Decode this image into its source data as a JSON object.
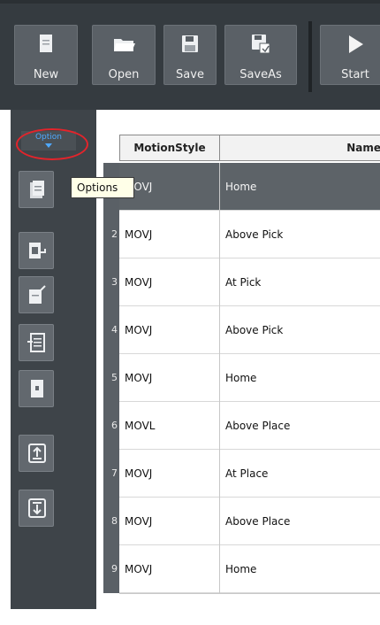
{
  "toolbar": {
    "buttons": [
      {
        "id": "new",
        "label": "New",
        "icon": "new-file-icon"
      },
      {
        "id": "open",
        "label": "Open",
        "icon": "folder-open-icon"
      },
      {
        "id": "save",
        "label": "Save",
        "icon": "floppy-disk-icon"
      },
      {
        "id": "saveas",
        "label": "SaveAs",
        "icon": "save-as-icon"
      },
      {
        "id": "start",
        "label": "Start",
        "icon": "play-icon"
      }
    ]
  },
  "sidebar": {
    "option_label": "Option",
    "tooltip": "Options",
    "tool_icons": [
      "options-document-icon",
      "export-document-icon",
      "edit-document-icon",
      "import-document-icon",
      "blank-document-icon",
      "move-up-icon",
      "move-down-icon"
    ]
  },
  "table": {
    "columns": [
      "MotionStyle",
      "Name"
    ],
    "rows": [
      {
        "num": "1",
        "style": "MOVJ",
        "name": "Home"
      },
      {
        "num": "2",
        "style": "MOVJ",
        "name": "Above Pick"
      },
      {
        "num": "3",
        "style": "MOVJ",
        "name": "At Pick"
      },
      {
        "num": "4",
        "style": "MOVJ",
        "name": "Above Pick"
      },
      {
        "num": "5",
        "style": "MOVJ",
        "name": "Home"
      },
      {
        "num": "6",
        "style": "MOVL",
        "name": "Above Place"
      },
      {
        "num": "7",
        "style": "MOVJ",
        "name": "At Place"
      },
      {
        "num": "8",
        "style": "MOVJ",
        "name": "Above Place"
      },
      {
        "num": "9",
        "style": "MOVJ",
        "name": "Home"
      }
    ]
  },
  "colors": {
    "toolbar_bg": "#353b40",
    "button_bg": "#5a6066",
    "option_text": "#4fa9ff",
    "highlight_oval": "#e3242b",
    "selected_row": "#5d6368"
  }
}
